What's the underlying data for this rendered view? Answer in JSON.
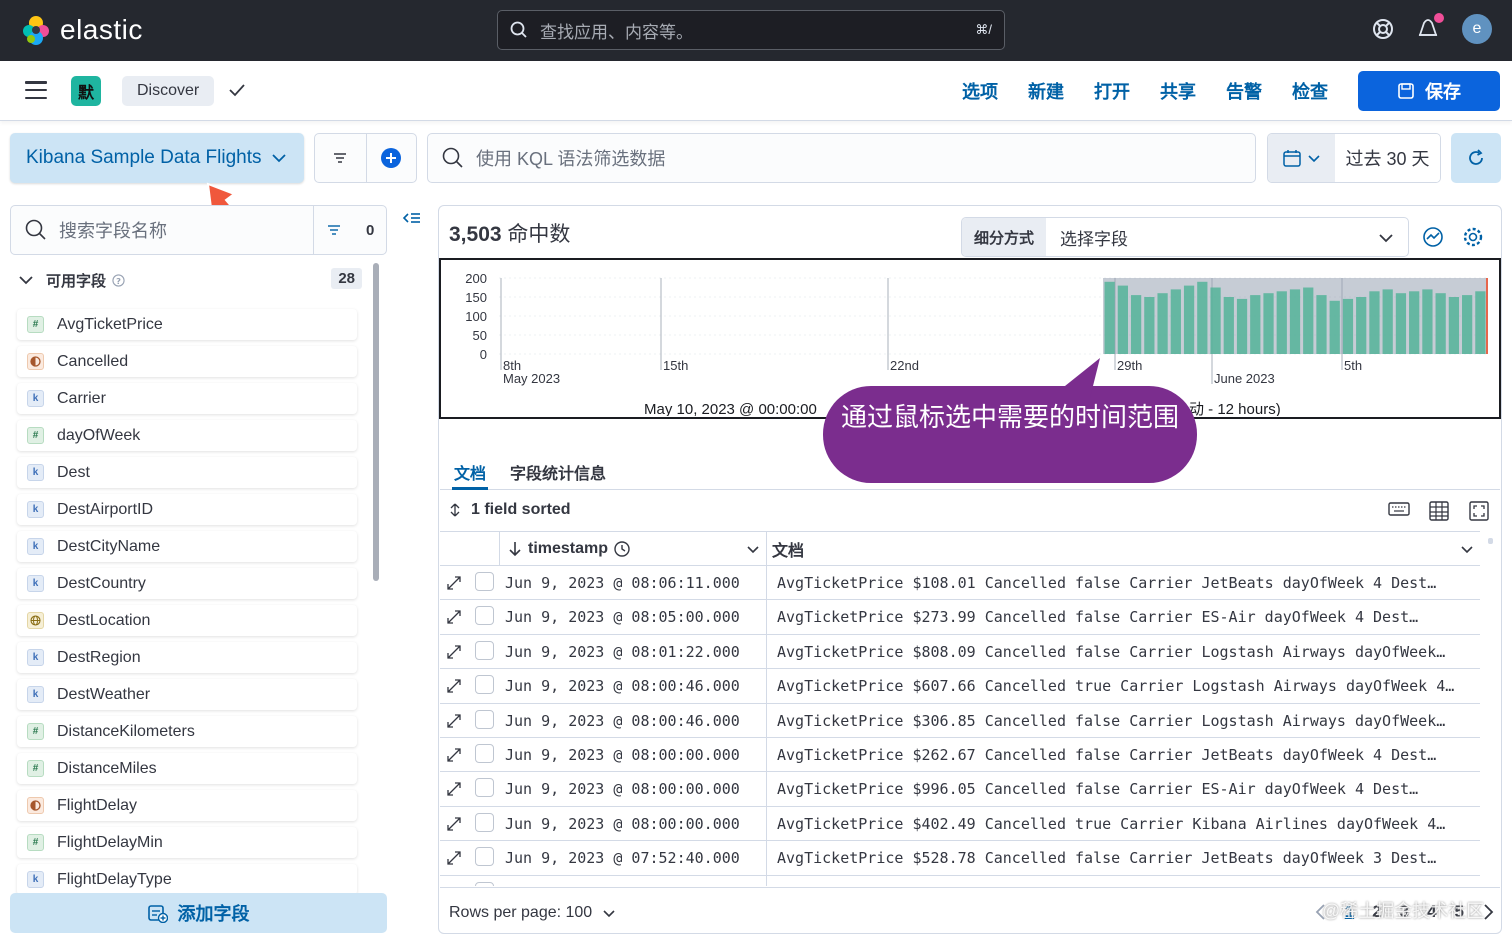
{
  "brand": {
    "name": "elastic"
  },
  "global_search": {
    "placeholder": "查找应用、内容等。",
    "shortcut": "⌘/"
  },
  "user": {
    "avatar_initial": "e"
  },
  "app_bar": {
    "space_initial": "默",
    "breadcrumb": "Discover",
    "menu": [
      "选项",
      "新建",
      "打开",
      "共享",
      "告警",
      "检查"
    ],
    "save_label": "保存"
  },
  "query_bar": {
    "data_view": "Kibana Sample Data Flights",
    "kql_placeholder": "使用 KQL 语法筛选数据",
    "time_range": "过去 30 天"
  },
  "sidebar": {
    "search_placeholder": "搜索字段名称",
    "filter_count": "0",
    "available_label": "可用字段",
    "available_count": "28",
    "fields": [
      {
        "name": "AvgTicketPrice",
        "type": "number",
        "glyph": "#"
      },
      {
        "name": "Cancelled",
        "type": "boolean",
        "glyph": ""
      },
      {
        "name": "Carrier",
        "type": "keyword",
        "glyph": "k"
      },
      {
        "name": "dayOfWeek",
        "type": "number",
        "glyph": "#"
      },
      {
        "name": "Dest",
        "type": "keyword",
        "glyph": "k"
      },
      {
        "name": "DestAirportID",
        "type": "keyword",
        "glyph": "k"
      },
      {
        "name": "DestCityName",
        "type": "keyword",
        "glyph": "k"
      },
      {
        "name": "DestCountry",
        "type": "keyword",
        "glyph": "k"
      },
      {
        "name": "DestLocation",
        "type": "geo",
        "glyph": ""
      },
      {
        "name": "DestRegion",
        "type": "keyword",
        "glyph": "k"
      },
      {
        "name": "DestWeather",
        "type": "keyword",
        "glyph": "k"
      },
      {
        "name": "DistanceKilometers",
        "type": "number",
        "glyph": "#"
      },
      {
        "name": "DistanceMiles",
        "type": "number",
        "glyph": "#"
      },
      {
        "name": "FlightDelay",
        "type": "boolean",
        "glyph": ""
      },
      {
        "name": "FlightDelayMin",
        "type": "number",
        "glyph": "#"
      },
      {
        "name": "FlightDelayType",
        "type": "keyword",
        "glyph": "k"
      }
    ],
    "add_field_label": "添加字段"
  },
  "results": {
    "hits_count": "3,503",
    "hits_label": "命中数",
    "breakdown_label": "细分方式",
    "breakdown_placeholder": "选择字段"
  },
  "chart_data": {
    "type": "bar",
    "y_ticks": [
      "200",
      "150",
      "100",
      "50",
      "0"
    ],
    "ylim": [
      0,
      200
    ],
    "x_tick_labels": [
      {
        "label": "8th",
        "sub": "May 2023"
      },
      {
        "label": "15th",
        "sub": ""
      },
      {
        "label": "22nd",
        "sub": ""
      },
      {
        "label": "29th",
        "sub": ""
      },
      {
        "label": "",
        "sub": "June 2023"
      },
      {
        "label": "5th",
        "sub": ""
      }
    ],
    "values": [
      190,
      180,
      155,
      150,
      160,
      170,
      180,
      190,
      175,
      150,
      145,
      155,
      160,
      165,
      170,
      175,
      155,
      140,
      145,
      150,
      165,
      170,
      160,
      165,
      170,
      160,
      150,
      155,
      165
    ],
    "caption_left": "May 10, 2023 @ 00:00:00",
    "caption_right": "动 - 12 hours)",
    "bar_color": "#54b399"
  },
  "callout": {
    "text": "通过鼠标选中需要的时间范围"
  },
  "tabs": [
    {
      "label": "文档"
    },
    {
      "label": "字段统计信息"
    }
  ],
  "sort": {
    "label": "1 field sorted"
  },
  "grid": {
    "col_timestamp": "timestamp",
    "col_doc": "文档",
    "rows": [
      {
        "ts": "Jun 9, 2023 @ 08:06:11.000",
        "doc": "AvgTicketPrice $108.01 Cancelled false Carrier JetBeats dayOfWeek 4 Dest…"
      },
      {
        "ts": "Jun 9, 2023 @ 08:05:00.000",
        "doc": "AvgTicketPrice $273.99 Cancelled false Carrier ES-Air dayOfWeek 4 Dest…"
      },
      {
        "ts": "Jun 9, 2023 @ 08:01:22.000",
        "doc": "AvgTicketPrice $808.09 Cancelled false Carrier Logstash Airways dayOfWeek…"
      },
      {
        "ts": "Jun 9, 2023 @ 08:00:46.000",
        "doc": "AvgTicketPrice $607.66 Cancelled true Carrier Logstash Airways dayOfWeek 4…"
      },
      {
        "ts": "Jun 9, 2023 @ 08:00:46.000",
        "doc": "AvgTicketPrice $306.85 Cancelled false Carrier Logstash Airways dayOfWeek…"
      },
      {
        "ts": "Jun 9, 2023 @ 08:00:00.000",
        "doc": "AvgTicketPrice $262.67 Cancelled false Carrier JetBeats dayOfWeek 4 Dest…"
      },
      {
        "ts": "Jun 9, 2023 @ 08:00:00.000",
        "doc": "AvgTicketPrice $996.05 Cancelled false Carrier ES-Air dayOfWeek 4 Dest…"
      },
      {
        "ts": "Jun 9, 2023 @ 08:00:00.000",
        "doc": "AvgTicketPrice $402.49 Cancelled true Carrier Kibana Airlines dayOfWeek 4…"
      },
      {
        "ts": "Jun 9, 2023 @ 07:52:40.000",
        "doc": "AvgTicketPrice $528.78 Cancelled false Carrier JetBeats dayOfWeek 3 Dest…"
      }
    ]
  },
  "footer": {
    "rows_per_page": "Rows per page: 100",
    "pages": [
      "1",
      "2",
      "3",
      "4",
      "5"
    ],
    "watermark": "@稀土掘金技术社区"
  }
}
